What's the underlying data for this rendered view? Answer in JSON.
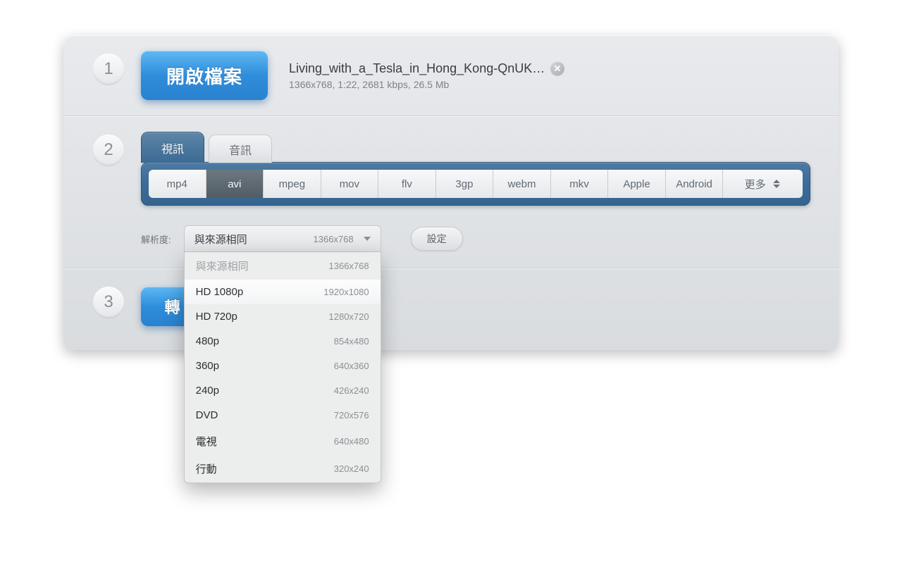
{
  "step_labels": {
    "s1": "1",
    "s2": "2",
    "s3": "3"
  },
  "section1": {
    "open_button": "開啟檔案",
    "file_name": "Living_with_a_Tesla_in_Hong_Kong-QnUK…",
    "file_meta": "1366x768, 1:22, 2681 kbps, 26.5 Mb"
  },
  "section2": {
    "tabs": {
      "video": "視訊",
      "audio": "音訊"
    },
    "formats": [
      "mp4",
      "avi",
      "mpeg",
      "mov",
      "flv",
      "3gp",
      "webm",
      "mkv",
      "Apple",
      "Android"
    ],
    "more_label": "更多",
    "selected_format": "avi",
    "resolution_label": "解析度:",
    "selected_resolution": {
      "name": "與來源相同",
      "dim": "1366x768"
    },
    "resolution_options": [
      {
        "name": "與來源相同",
        "dim": "1366x768",
        "current": true
      },
      {
        "name": "HD 1080p",
        "dim": "1920x1080",
        "hover": true
      },
      {
        "name": "HD 720p",
        "dim": "1280x720"
      },
      {
        "name": "480p",
        "dim": "854x480"
      },
      {
        "name": "360p",
        "dim": "640x360"
      },
      {
        "name": "240p",
        "dim": "426x240"
      },
      {
        "name": "DVD",
        "dim": "720x576"
      },
      {
        "name": "電視",
        "dim": "640x480"
      },
      {
        "name": "行動",
        "dim": "320x240"
      }
    ],
    "settings_button": "設定"
  },
  "section3": {
    "convert_button": "轉"
  }
}
